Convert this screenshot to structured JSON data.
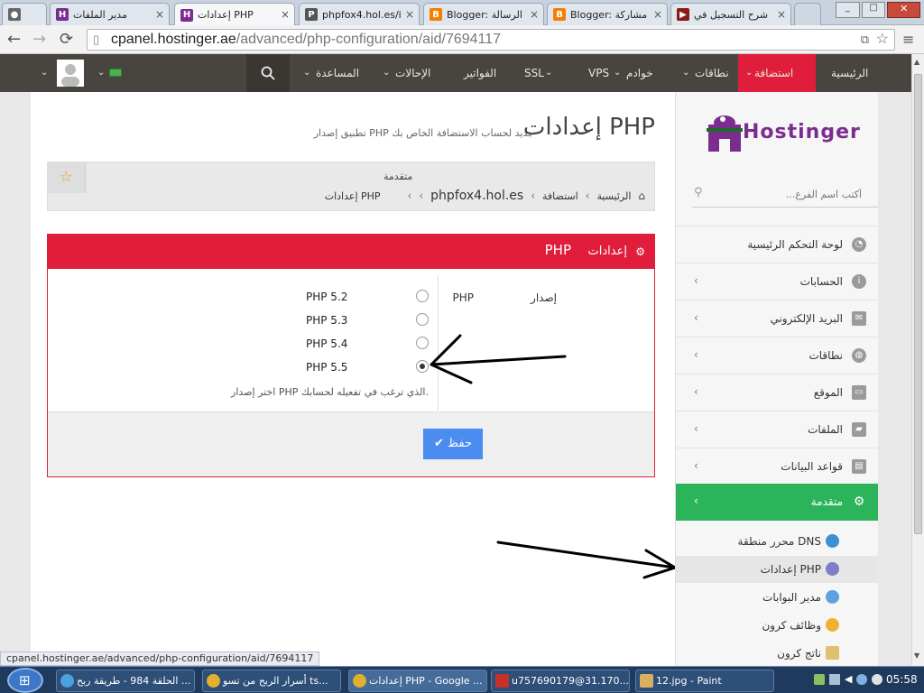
{
  "browser": {
    "tabs": [
      {
        "title": "",
        "icon": "spy-icon"
      },
      {
        "title": "مدير الملفات",
        "icon": "hostinger-icon"
      },
      {
        "title": "إعدادات PHP",
        "icon": "hostinger-icon"
      },
      {
        "title": "phpfox4.hol.es/i",
        "icon": "pf-icon"
      },
      {
        "title": "Blogger: الرسالة",
        "icon": "blogger-icon"
      },
      {
        "title": "Blogger: مشاركة",
        "icon": "blogger-icon"
      },
      {
        "title": "شرح التسجيل في",
        "icon": "video-icon"
      }
    ],
    "url_host": "cpanel.hostinger.ae",
    "url_path": "/advanced/php-configuration/aid/7694117",
    "status_url": "cpanel.hostinger.ae/advanced/php-configuration/aid/7694117"
  },
  "topnav": {
    "items": [
      "الرئيسية",
      "استضافة",
      "نطاقات",
      "خوادم",
      "VPS",
      "SSL",
      "الفواتير",
      "الإحالات",
      "المساعدة"
    ]
  },
  "sidebar": {
    "logo": "Hostinger",
    "search_placeholder": "أكتب اسم الفرع...",
    "items": [
      {
        "label": "لوحة التحكم الرئيسية"
      },
      {
        "label": "الحسابات"
      },
      {
        "label": "البريد الإلكتروني"
      },
      {
        "label": "نطاقات"
      },
      {
        "label": "الموقع"
      },
      {
        "label": "الملفات"
      },
      {
        "label": "قواعد البيانات"
      },
      {
        "label": "متقدمة"
      }
    ],
    "subitems": [
      {
        "label": "محرر منطقة DNS"
      },
      {
        "label": "إعدادات PHP"
      },
      {
        "label": "مدير البوابات"
      },
      {
        "label": "وظائف كرون"
      },
      {
        "label": "ناتج كرون"
      }
    ]
  },
  "page": {
    "title": "إعدادات PHP",
    "subtitle": "تطبيق إصدار PHP جديد لحساب الاستضافة الخاص بك",
    "breadcrumb": {
      "section": "متقدمة",
      "home": "الرئيسية",
      "hosting": "استضافة",
      "domain": "phpfox4.hol.es",
      "current": "إعدادات PHP"
    }
  },
  "panel": {
    "title": "إعدادات",
    "title_php": "PHP",
    "field_label": "إصدار",
    "field_label_php": "PHP",
    "options": [
      "PHP 5.2",
      "PHP 5.3",
      "PHP 5.4",
      "PHP 5.5"
    ],
    "selected": "PHP 5.5",
    "help": "اختر إصدار PHP الذي ترغب في تفعيله لحسابك.",
    "save_label": "حفظ"
  },
  "taskbar": {
    "items": [
      {
        "label": "الحلقة 984 - طريقة ربح ..."
      },
      {
        "label": "أسرار الربح من تسو ts..."
      },
      {
        "label": "إعدادات PHP - Google ..."
      },
      {
        "label": "u757690179@31.170...."
      },
      {
        "label": "12.jpg - Paint"
      }
    ],
    "clock": "05:58"
  },
  "colors": {
    "brand_red": "#e01e3c",
    "accent_green": "#2cb45a",
    "save_blue": "#4a8cf0",
    "topnav": "#48443f"
  }
}
